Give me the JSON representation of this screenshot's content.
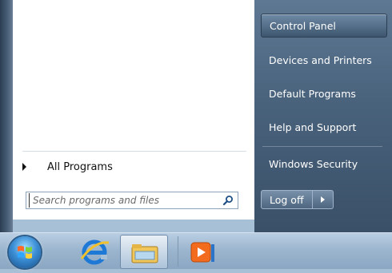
{
  "start_menu": {
    "left_pane": {
      "all_programs_label": "All Programs",
      "search_placeholder": "Search programs and files"
    },
    "right_pane": {
      "items": [
        {
          "label": "Control Panel",
          "highlighted": true
        },
        {
          "label": "Devices and Printers",
          "highlighted": false
        },
        {
          "label": "Default Programs",
          "highlighted": false
        },
        {
          "label": "Help and Support",
          "highlighted": false
        },
        {
          "label": "Windows Security",
          "highlighted": false
        }
      ],
      "logoff_label": "Log off"
    }
  },
  "taskbar": {
    "start_icon": "windows-orb-icon",
    "pinned": [
      {
        "name": "internet-explorer-icon",
        "active": false
      },
      {
        "name": "file-explorer-icon",
        "active": true
      },
      {
        "name": "media-player-icon",
        "active": false
      }
    ]
  },
  "colors": {
    "right_pane": "#4f6882",
    "taskbar": "#a3bbd3",
    "highlight": "#3e5670"
  }
}
